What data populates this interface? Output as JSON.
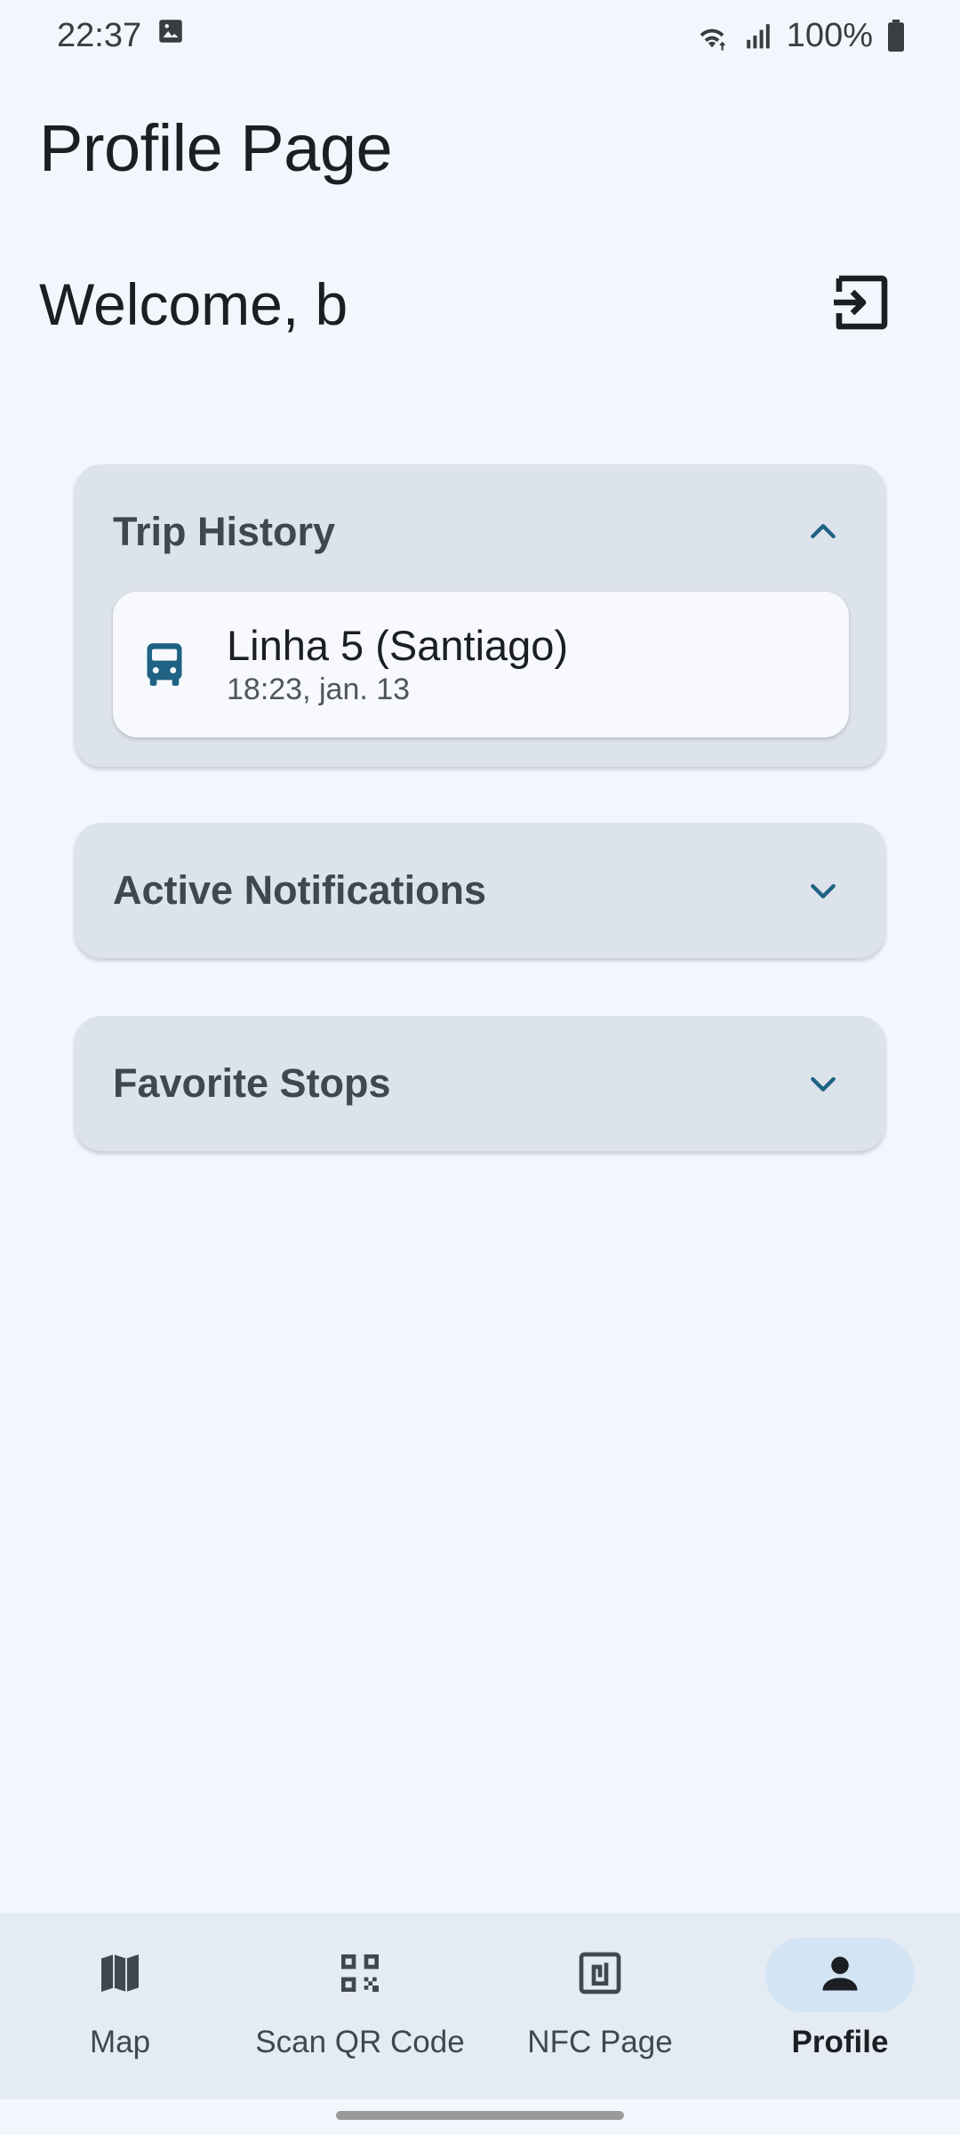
{
  "status_bar": {
    "time": "22:37",
    "battery": "100%",
    "icons": [
      "image-icon",
      "wifi-icon",
      "signal-icon",
      "battery-icon"
    ]
  },
  "page": {
    "title": "Profile Page",
    "welcome": "Welcome, b"
  },
  "sections": {
    "trip_history": {
      "title": "Trip History",
      "expanded": true,
      "items": [
        {
          "route": "Linha 5 (Santiago)",
          "time": "18:23, jan. 13",
          "icon": "bus-icon"
        }
      ]
    },
    "active_notifications": {
      "title": "Active Notifications",
      "expanded": false
    },
    "favorite_stops": {
      "title": "Favorite Stops",
      "expanded": false
    }
  },
  "nav": {
    "items": [
      {
        "label": "Map",
        "icon": "map-icon",
        "active": false
      },
      {
        "label": "Scan QR Code",
        "icon": "qr-code-icon",
        "active": false
      },
      {
        "label": "NFC Page",
        "icon": "nfc-icon",
        "active": false
      },
      {
        "label": "Profile",
        "icon": "person-icon",
        "active": true
      }
    ]
  },
  "colors": {
    "background": "#f1f7fd",
    "card": "#dde3ea",
    "accent": "#1f6283",
    "nav_active_pill": "#d3e4f5"
  }
}
